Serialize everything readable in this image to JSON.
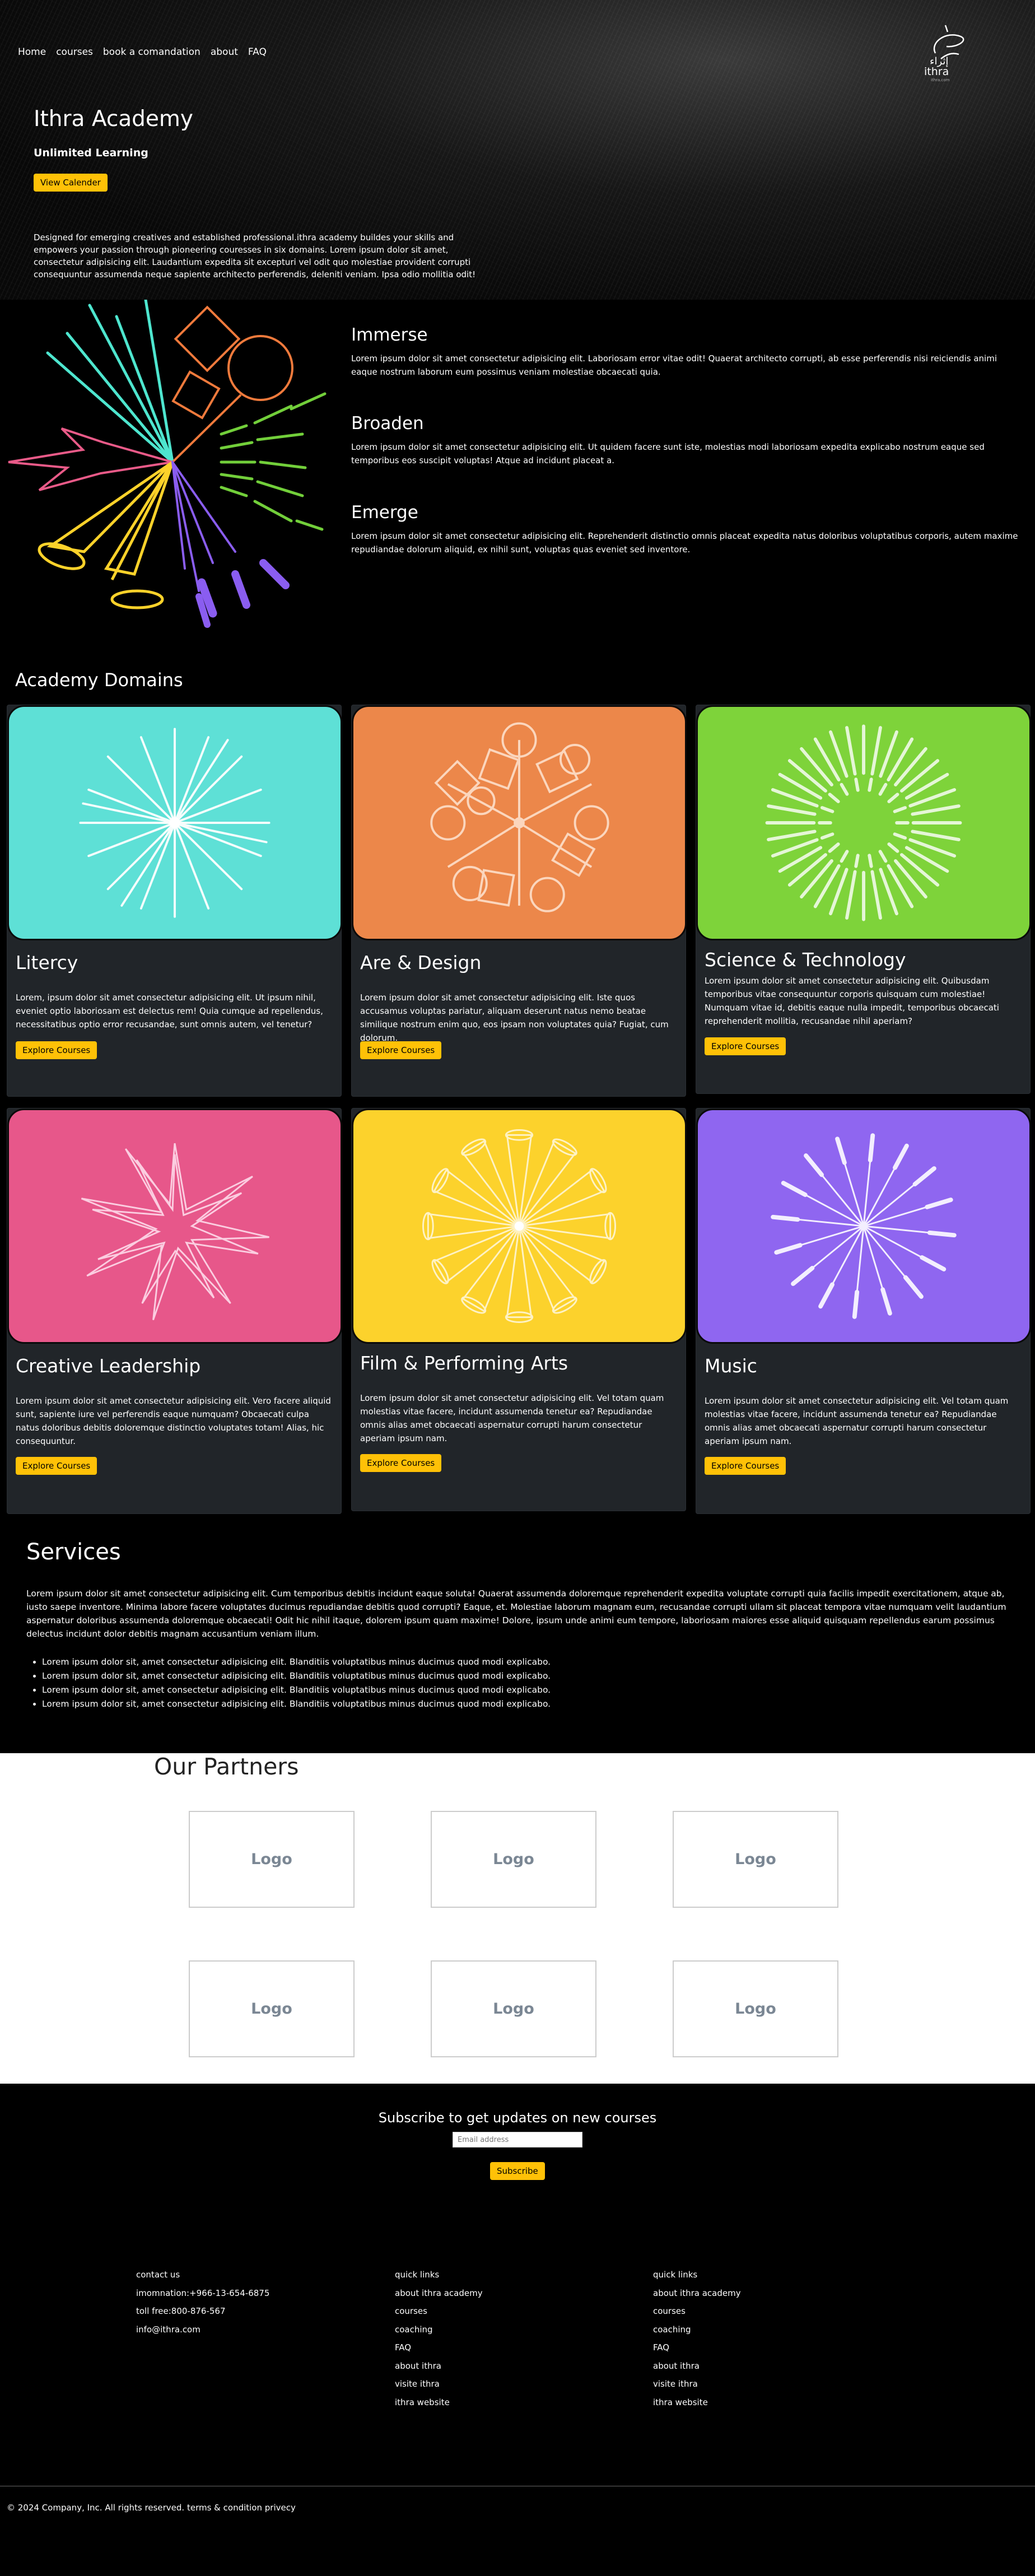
{
  "nav": {
    "items": [
      "Home",
      "courses",
      "book a comandation",
      "about",
      "FAQ"
    ]
  },
  "logo": {
    "brand": "ithra",
    "arabic": "إثراء",
    "tiny": "ithra.com"
  },
  "hero": {
    "title": "Ithra Academy",
    "subtitle": "Unlimited Learning",
    "button": "View Calender",
    "description": "Designed for emerging creatives and established professional.ithra academy buildes your skills and empowers your passion through pioneering couresses in six domains. Lorem ipsum dolor sit amet, consectetur adipisicing elit. Laudantium expedita sit excepturi vel odit quo molestiae provident corrupti consequuntur assumenda neque sapiente architecto perferendis, deleniti veniam. Ipsa odio mollitia odit!"
  },
  "features": [
    {
      "title": "Immerse",
      "text": "Lorem ipsum dolor sit amet consectetur adipisicing elit. Laboriosam error vitae odit! Quaerat architecto corrupti, ab esse perferendis nisi reiciendis animi eaque nostrum laborum eum possimus veniam molestiae obcaecati quia."
    },
    {
      "title": "Broaden",
      "text": "Lorem ipsum dolor sit amet consectetur adipisicing elit. Ut quidem facere sunt iste, molestias modi laboriosam expedita explicabo nostrum eaque sed temporibus eos suscipit voluptas! Atque ad incidunt placeat a."
    },
    {
      "title": "Emerge",
      "text": "Lorem ipsum dolor sit amet consectetur adipisicing elit. Reprehenderit distinctio omnis placeat expedita natus doloribus voluptatibus corporis, autem maxime repudiandae dolorum aliquid, ex nihil sunt, voluptas quas eveniet sed inventore."
    }
  ],
  "domains": {
    "title": "Academy Domains",
    "cards": [
      {
        "title": "Litercy",
        "color": "#5ee0d6",
        "button": "Explore Courses",
        "text": "Lorem, ipsum dolor sit amet consectetur adipisicing elit. Ut ipsum nihil, eveniet optio laboriosam est delectus rem! Quia cumque ad repellendus, necessitatibus optio error recusandae, sunt omnis autem, vel tenetur?"
      },
      {
        "title": "Are & Design",
        "color": "#ec874a",
        "button": "Explore Courses",
        "text": "Lorem ipsum dolor sit amet consectetur adipisicing elit. Iste quos accusamus voluptas pariatur, aliquam deserunt natus nemo beatae similique nostrum enim quo, eos ipsam non voluptates quia? Fugiat, cum dolorum."
      },
      {
        "title": "Science & Technology",
        "color": "#7ed33a",
        "button": "Explore Courses",
        "text": "Lorem ipsum dolor sit amet consectetur adipisicing elit. Quibusdam temporibus vitae consequuntur corporis quisquam cum molestiae! Numquam vitae id, debitis eaque nulla impedit, temporibus obcaecati reprehenderit mollitia, recusandae nihil aperiam?"
      },
      {
        "title": "Creative Leadership",
        "color": "#e7578a",
        "button": "Explore Courses",
        "text": "Lorem ipsum dolor sit amet consectetur adipisicing elit. Vero facere aliquid sunt, sapiente iure vel perferendis eaque numquam? Obcaecati culpa natus doloribus debitis doloremque distinctio voluptates totam! Alias, hic consequuntur."
      },
      {
        "title": "Film & Performing Arts",
        "color": "#fcd22c",
        "button": "Explore Courses",
        "text": "Lorem ipsum dolor sit amet consectetur adipisicing elit. Vel totam quam molestias vitae facere, incidunt assumenda tenetur ea? Repudiandae omnis alias amet obcaecati aspernatur corrupti harum consectetur aperiam ipsum nam."
      },
      {
        "title": "Music",
        "color": "#8f66f0",
        "button": "Explore Courses",
        "text": "Lorem ipsum dolor sit amet consectetur adipisicing elit. Vel totam quam molestias vitae facere, incidunt assumenda tenetur ea? Repudiandae omnis alias amet obcaecati aspernatur corrupti harum consectetur aperiam ipsum nam."
      }
    ]
  },
  "services": {
    "title": "Services",
    "lead": "Lorem ipsum dolor sit amet consectetur adipisicing elit. Cum temporibus debitis incidunt eaque soluta! Quaerat assumenda doloremque reprehenderit expedita voluptate corrupti quia facilis impedit exercitationem, atque ab, iusto saepe inventore. Minima labore facere voluptates ducimus repudiandae debitis quod corrupti? Eaque, et. Molestiae laborum magnam eum, recusandae corrupti ullam sit placeat tempora vitae numquam velit laudantium aspernatur doloribus assumenda doloremque obcaecati! Odit hic nihil itaque, dolorem ipsum quam maxime! Dolore, ipsum unde animi eum tempore, laboriosam maiores esse aliquid quisquam repellendus earum possimus delectus incidunt dolor debitis magnam accusantium veniam illum.",
    "bullets": [
      "Lorem ipsum dolor sit, amet consectetur adipisicing elit. Blanditiis voluptatibus minus ducimus quod modi explicabo.",
      "Lorem ipsum dolor sit, amet consectetur adipisicing elit. Blanditiis voluptatibus minus ducimus quod modi explicabo.",
      "Lorem ipsum dolor sit, amet consectetur adipisicing elit. Blanditiis voluptatibus minus ducimus quod modi explicabo.",
      "Lorem ipsum dolor sit, amet consectetur adipisicing elit. Blanditiis voluptatibus minus ducimus quod modi explicabo."
    ]
  },
  "partners": {
    "title": "Our Partners",
    "logos": [
      "Logo",
      "Logo",
      "Logo",
      "Logo",
      "Logo",
      "Logo"
    ]
  },
  "subscribe": {
    "title": "Subscribe to get updates on new courses",
    "placeholder": "Email address",
    "button": "Subscribe"
  },
  "footer": {
    "contact": [
      "contact us",
      "imomnation:+966-13-654-6875",
      "toll free:800-876-567",
      "info@ithra.com"
    ],
    "links1": [
      "quick links",
      "about ithra academy",
      "courses",
      "coaching",
      "FAQ",
      "about ithra",
      "visite ithra",
      "ithra website"
    ],
    "links2": [
      "quick links",
      "about ithra academy",
      "courses",
      "coaching",
      "FAQ",
      "about ithra",
      "visite ithra",
      "ithra website"
    ],
    "copyright_prefix": "© 2024 Company, Inc. All rights reserved.",
    "terms": "terms & condition",
    "privacy": "privecy"
  }
}
